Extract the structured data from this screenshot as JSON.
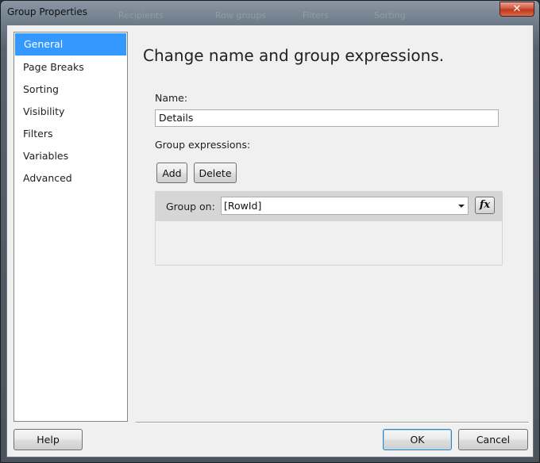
{
  "window": {
    "title": "Group Properties",
    "close_glyph": "✕",
    "background_hints": [
      "Recipients",
      "Row groups",
      "Filters",
      "Sorting"
    ]
  },
  "nav": {
    "items": [
      {
        "label": "General",
        "selected": true
      },
      {
        "label": "Page Breaks",
        "selected": false
      },
      {
        "label": "Sorting",
        "selected": false
      },
      {
        "label": "Visibility",
        "selected": false
      },
      {
        "label": "Filters",
        "selected": false
      },
      {
        "label": "Variables",
        "selected": false
      },
      {
        "label": "Advanced",
        "selected": false
      }
    ]
  },
  "main": {
    "heading": "Change name and group expressions.",
    "name_label": "Name:",
    "name_value": "Details",
    "group_expressions_label": "Group expressions:",
    "add_label": "Add",
    "delete_label": "Delete",
    "group_on_label": "Group on:",
    "group_on_value": "[RowId]",
    "fx_label": "fx"
  },
  "footer": {
    "help_label": "Help",
    "ok_label": "OK",
    "cancel_label": "Cancel"
  },
  "colors": {
    "selection": "#3399ff",
    "close_button": "#c0391d"
  }
}
